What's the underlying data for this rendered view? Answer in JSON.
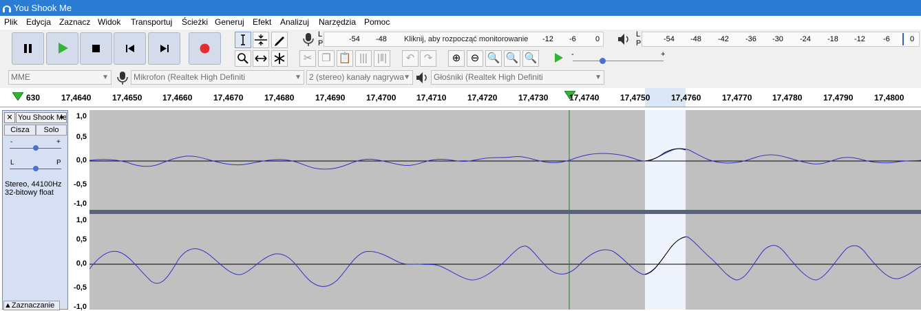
{
  "window": {
    "title": "You Shook Me"
  },
  "menu": [
    "Plik",
    "Edycja",
    "Zaznacz",
    "Widok",
    "Transportuj",
    "Ścieżki",
    "Generuj",
    "Efekt",
    "Analizuj",
    "Narzędzia",
    "Pomoc"
  ],
  "meters": {
    "record_hint": "Kliknij, aby rozpocząć monitorowanie",
    "record_ticks": [
      "-54",
      "-48",
      "-12",
      "-6",
      "0"
    ],
    "play_ticks": [
      "-54",
      "-48",
      "-42",
      "-36",
      "-30",
      "-24",
      "-18",
      "-12",
      "-6",
      "0"
    ],
    "lr": [
      "L",
      "P"
    ],
    "slider_minus": "-",
    "slider_plus": "+"
  },
  "device": {
    "host": "MME",
    "mic": "Mikrofon (Realtek High Definiti",
    "channels": "2 (stereo) kanały nagrywa",
    "speakers": "Głośniki (Realtek High Definiti"
  },
  "timeline": [
    "630",
    "17,4640",
    "17,4650",
    "17,4660",
    "17,4670",
    "17,4680",
    "17,4690",
    "17,4700",
    "17,4710",
    "17,4720",
    "17,4730",
    "17,4740",
    "17,4750",
    "17,4760",
    "17,4770",
    "17,4780",
    "17,4790",
    "17,4800"
  ],
  "track": {
    "name": "You Shook Me",
    "mute": "Cisza",
    "solo": "Solo",
    "gain_minus": "-",
    "gain_plus": "+",
    "pan_left": "L",
    "pan_right": "P",
    "info1": "Stereo, 44100Hz",
    "info2": "32-bitowy float",
    "select": "Zaznaczanie"
  },
  "vruler": [
    "1,0",
    "0,5",
    "0,0",
    "-0,5",
    "-1,0"
  ],
  "colors": {
    "titlebar": "#2b7cd3",
    "wave": "#3232c8",
    "waveBg": "#c0c0c0",
    "selection": "#eef3fc",
    "cursor": "#237a23"
  }
}
